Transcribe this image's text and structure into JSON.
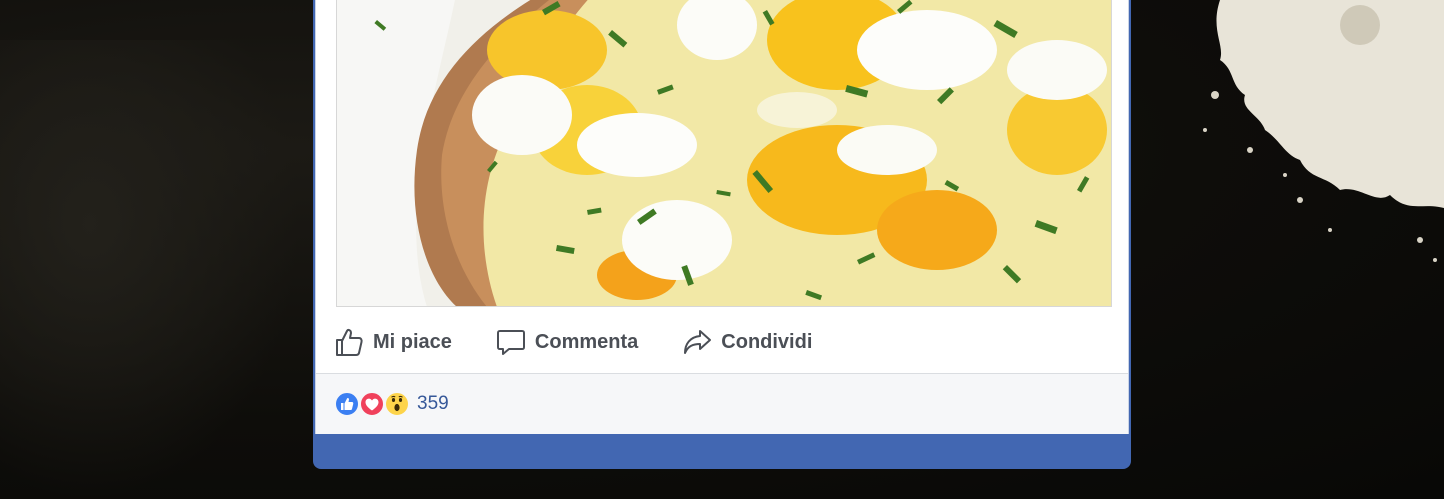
{
  "post": {
    "actions": {
      "like_label": "Mi piace",
      "comment_label": "Commenta",
      "share_label": "Condividi"
    },
    "reactions": {
      "types": [
        "like-icon",
        "love-icon",
        "wow-icon"
      ],
      "count": "359"
    }
  },
  "colors": {
    "facebook_blue": "#4267b2",
    "action_text": "#4b4f56",
    "count_text": "#365899",
    "like": "#3b7ff2",
    "love": "#f0415c",
    "wow": "#fdd44b"
  }
}
